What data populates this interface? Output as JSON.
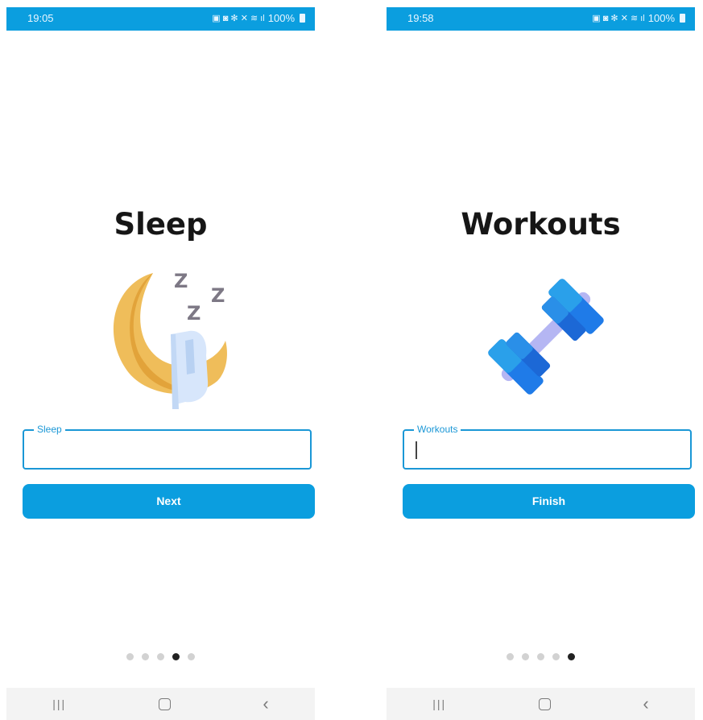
{
  "screens": [
    {
      "status_time": "19:05",
      "battery": "100%",
      "title": "Sleep",
      "icon": "sleep-moon-icon",
      "field_label": "Sleep",
      "field_value": "",
      "button_label": "Next",
      "dots_total": 5,
      "active_dot": 4
    },
    {
      "status_time": "19:58",
      "battery": "100%",
      "title": "Workouts",
      "icon": "dumbbell-icon",
      "field_label": "Workouts",
      "field_value": "",
      "button_label": "Finish",
      "dots_total": 5,
      "active_dot": 5
    }
  ],
  "colors": {
    "accent": "#0b9edf",
    "field_border": "#1a97d6",
    "title": "#161616"
  }
}
